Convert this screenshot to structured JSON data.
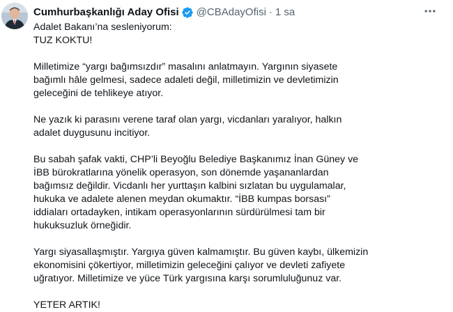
{
  "author": {
    "name": "Cumhurbaşkanlığı Aday Ofisi",
    "handle": "@CBAdayOfisi",
    "separator": "·",
    "time": "1 sa"
  },
  "icons": {
    "verified": "verified-badge-icon",
    "more": "more-horizontal-icon",
    "verified_color": "#1d9bf0"
  },
  "tweet": {
    "p1_l1": "Adalet Bakanı’na sesleniyorum:",
    "p1_l2": "TUZ KOKTU!",
    "p2_l1": "Milletimize “yargı bağımsızdır” masalını anlatmayın. Yargının siyasete",
    "p2_l2": "bağımlı hâle gelmesi, sadece adaleti değil, milletimizin ve devletimizin",
    "p2_l3": "geleceğini de tehlikeye atıyor.",
    "p3_l1": "Ne yazık ki parasını verene taraf olan yargı, vicdanları yaralıyor, halkın",
    "p3_l2": "adalet duygusunu incitiyor.",
    "p4_l1": "Bu sabah şafak vakti, CHP’li Beyoğlu Belediye Başkanımız İnan Güney ve",
    "p4_l2": "İBB bürokratlarına yönelik operasyon, son dönemde yaşananlardan",
    "p4_l3": "bağımsız değildir. Vicdanlı her yurttaşın kalbini sızlatan bu uygulamalar,",
    "p4_l4": "hukuka ve adalete alenen meydan okumaktır. “İBB kumpas borsası”",
    "p4_l5": "iddiaları ortadayken, intikam operasyonlarının sürdürülmesi tam bir",
    "p4_l6": "hukuksuzluk örneğidir.",
    "p5_l1": "Yargı siyasallaşmıştır. Yargıya güven kalmamıştır. Bu güven kaybı, ülkemizin",
    "p5_l2": "ekonomisini çökertiyor, milletimizin geleceğini çalıyor ve devleti zafiyete",
    "p5_l3": "uğratıyor. Milletimize ve yüce Türk yargısına karşı sorumluluğunuz var.",
    "p6_l1": "YETER ARTIK!"
  }
}
